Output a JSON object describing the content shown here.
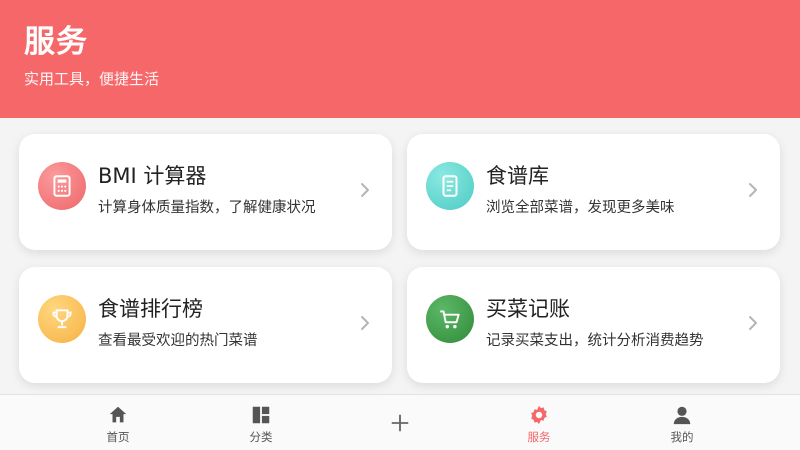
{
  "header": {
    "title": "服务",
    "subtitle": "实用工具，便捷生活",
    "color": "#f6676a"
  },
  "cards": [
    {
      "title": "BMI 计算器",
      "desc": "计算身体质量指数，了解健康状况",
      "icon": "calculator-icon",
      "color": "#f2767a"
    },
    {
      "title": "食谱库",
      "desc": "浏览全部菜谱，发现更多美味",
      "icon": "document-icon",
      "color": "#5fd6cf"
    },
    {
      "title": "食谱排行榜",
      "desc": "查看最受欢迎的热门菜谱",
      "icon": "trophy-icon",
      "color": "#f9c05a"
    },
    {
      "title": "买菜记账",
      "desc": "记录买菜支出，统计分析消费趋势",
      "icon": "cart-icon",
      "color": "#3c9b46"
    }
  ],
  "tabbar": {
    "items": [
      {
        "label": "首页",
        "icon": "home-icon"
      },
      {
        "label": "分类",
        "icon": "grid-icon"
      },
      {
        "label": "",
        "icon": "plus-icon"
      },
      {
        "label": "服务",
        "icon": "gear-icon",
        "active": true
      },
      {
        "label": "我的",
        "icon": "user-icon"
      }
    ],
    "active_color": "#f6676a",
    "inactive_color": "#555555"
  }
}
